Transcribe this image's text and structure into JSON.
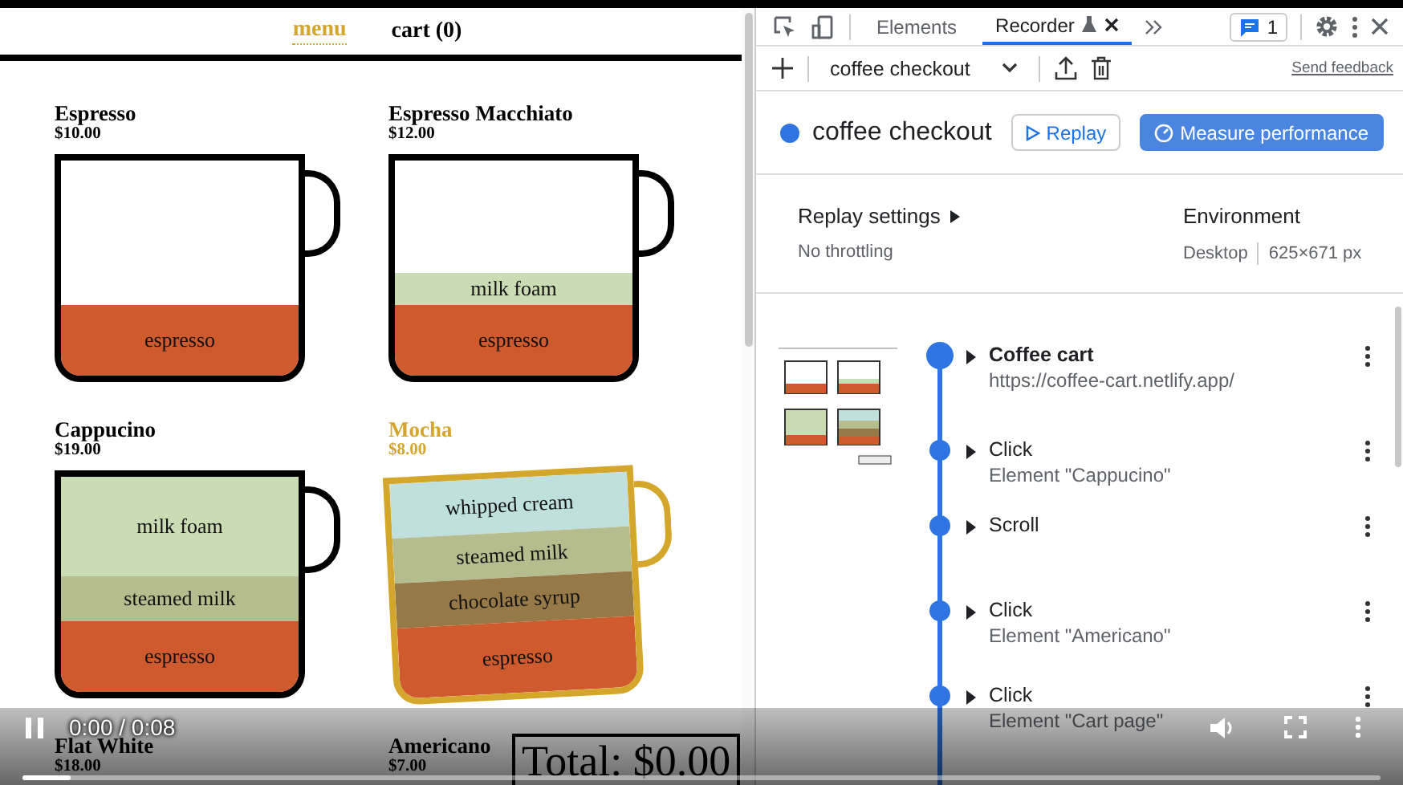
{
  "site": {
    "nav": [
      {
        "label": "menu",
        "selected": true
      },
      {
        "label": "cart (0)",
        "selected": false
      }
    ],
    "products": [
      {
        "name": "Espresso",
        "price": "$10.00",
        "highlighted": false,
        "full": false,
        "layers": [
          {
            "label": "espresso",
            "kind": "espresso"
          }
        ]
      },
      {
        "name": "Espresso Macchiato",
        "price": "$12.00",
        "highlighted": false,
        "full": false,
        "layers": [
          {
            "label": "milk foam",
            "kind": "milk-foam"
          },
          {
            "label": "espresso",
            "kind": "espresso"
          }
        ]
      },
      {
        "name": "Cappucino",
        "price": "$19.00",
        "highlighted": false,
        "full": true,
        "layers": [
          {
            "label": "milk foam",
            "kind": "milk-foam"
          },
          {
            "label": "steamed milk",
            "kind": "steamed-milk"
          },
          {
            "label": "espresso",
            "kind": "espresso"
          }
        ]
      },
      {
        "name": "Mocha",
        "price": "$8.00",
        "highlighted": true,
        "full": true,
        "layers": [
          {
            "label": "whipped cream",
            "kind": "whipped-cream"
          },
          {
            "label": "steamed milk",
            "kind": "steamed-milk"
          },
          {
            "label": "chocolate syrup",
            "kind": "chocolate-syrup"
          },
          {
            "label": "espresso",
            "kind": "espresso"
          }
        ]
      },
      {
        "name": "Flat White",
        "price": "$18.00",
        "highlighted": false
      },
      {
        "name": "Americano",
        "price": "$7.00",
        "highlighted": false
      }
    ],
    "total": "Total: $0.00"
  },
  "devtools": {
    "tabs": [
      {
        "label": "Elements",
        "selected": false,
        "closable": false
      },
      {
        "label": "Recorder",
        "selected": true,
        "closable": true
      }
    ],
    "issues_count": "1",
    "recording_select": "coffee checkout",
    "feedback_link": "Send feedback",
    "title": "coffee checkout",
    "replay_button": "Replay",
    "measure_button": "Measure performance",
    "replay_settings": {
      "label": "Replay settings",
      "value": "No throttling"
    },
    "environment": {
      "label": "Environment",
      "device": "Desktop",
      "viewport": "625×671 px"
    },
    "steps": [
      {
        "kind": "navigate",
        "title": "Coffee cart",
        "detail": "https://coffee-cart.netlify.app/"
      },
      {
        "kind": "action",
        "title": "Click",
        "detail": "Element \"Cappucino\""
      },
      {
        "kind": "action",
        "title": "Scroll"
      },
      {
        "kind": "action",
        "title": "Click",
        "detail": "Element \"Americano\""
      },
      {
        "kind": "action",
        "title": "Click",
        "detail": "Element \"Cart page\""
      }
    ]
  },
  "video": {
    "time": "0:00 / 0:08",
    "playing": true,
    "level": 0.035
  }
}
